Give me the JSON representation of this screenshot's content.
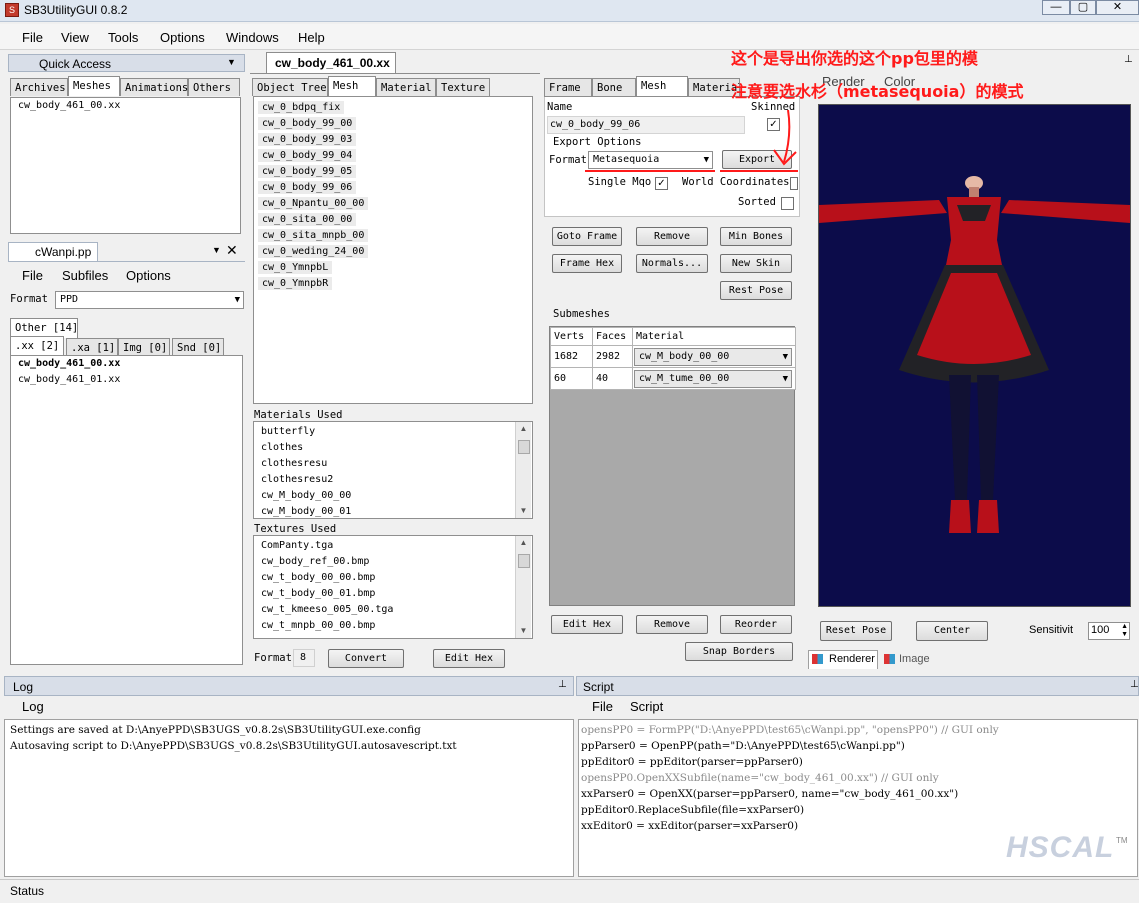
{
  "window": {
    "title": "SB3UtilityGUI 0.8.2",
    "min": "—",
    "max": "▢",
    "close": "✕"
  },
  "menu": [
    "File",
    "View",
    "Tools",
    "Options",
    "Windows",
    "Help"
  ],
  "quick_access": {
    "title": "Quick Access",
    "tabs": [
      "Archives",
      "Meshes",
      "Animations",
      "Others"
    ],
    "items": [
      "cw_body_461_00.xx"
    ]
  },
  "pp": {
    "title": "cWanpi.pp",
    "menu": [
      "File",
      "Subfiles",
      "Options"
    ],
    "format_label": "Format",
    "format_value": "PPD",
    "tab_other": "Other [14]",
    "tabs": [
      ".xx [2]",
      ".xa [1]",
      "Img [0]",
      "Snd [0]"
    ],
    "items": [
      "cw_body_461_00.xx",
      "cw_body_461_01.xx"
    ]
  },
  "xx": {
    "doc_tab": "cw_body_461_00.xx",
    "tabs": [
      "Object Tree",
      "Mesh",
      "Material",
      "Texture"
    ],
    "meshes": [
      "cw_0_bdpq_fix",
      "cw_0_body_99_00",
      "cw_0_body_99_03",
      "cw_0_body_99_04",
      "cw_0_body_99_05",
      "cw_0_body_99_06",
      "cw_0_Npantu_00_00",
      "cw_0_sita_00_00",
      "cw_0_sita_mnpb_00",
      "cw_0_weding_24_00",
      "cw_0_YmnpbL",
      "cw_0_YmnpbR"
    ],
    "materials_label": "Materials Used",
    "materials": [
      "butterfly",
      "clothes",
      "clothesresu",
      "clothesresu2",
      "cw_M_body_00_00",
      "cw_M_body_00_01"
    ],
    "textures_label": "Textures Used",
    "textures": [
      "ComPanty.tga",
      "cw_body_ref_00.bmp",
      "cw_t_body_00_00.bmp",
      "cw_t_body_00_01.bmp",
      "cw_t_kmeeso_005_00.tga",
      "cw_t_mnpb_00_00.bmp"
    ],
    "format_label": "Format",
    "format_value": "8",
    "convert": "Convert",
    "edit_hex": "Edit Hex"
  },
  "mesh_editor": {
    "tabs": [
      "Frame",
      "Bone",
      "Mesh",
      "Material"
    ],
    "name_label": "Name",
    "name_value": "cw_0_body_99_06",
    "skinned_label": "Skinned",
    "export_options": "Export Options",
    "format_label": "Format",
    "format_value": "Metasequoia",
    "export": "Export",
    "single_mqo": "Single Mqo",
    "world_coords": "World Coordinates",
    "sorted": "Sorted",
    "buttons": [
      "Goto Frame",
      "Remove",
      "Min Bones",
      "Frame Hex",
      "Normals...",
      "New Skin",
      "Rest Pose"
    ],
    "submeshes_label": "Submeshes",
    "columns": [
      "Verts",
      "Faces",
      "Material"
    ],
    "rows": [
      [
        "1682",
        "2982",
        "cw_M_body_00_00"
      ],
      [
        "60",
        "40",
        "cw_M_tume_00_00"
      ]
    ],
    "bottom_buttons": [
      "Edit Hex",
      "Remove",
      "Reorder",
      "Snap Borders"
    ]
  },
  "renderer": {
    "tabs": [
      "Render",
      "Color"
    ],
    "reset_pose": "Reset Pose",
    "center": "Center",
    "sensitivity_label": "Sensitivit",
    "sensitivity_value": "100",
    "bottom_tabs": [
      "Renderer",
      "Image"
    ],
    "bg": "#0c0c4a"
  },
  "annotations": [
    "这个是导出你选的这个pp包里的模",
    "注意要选水杉（metasequoia）的模式"
  ],
  "log": {
    "title": "Log",
    "menu": "Log",
    "lines": [
      "Settings are saved at D:\\AnyePPD\\SB3UGS_v0.8.2s\\SB3UtilityGUI.exe.config",
      "Autosaving script to D:\\AnyePPD\\SB3UGS_v0.8.2s\\SB3UtilityGUI.autosavescript.txt"
    ]
  },
  "script": {
    "title": "Script",
    "menu": [
      "File",
      "Script"
    ],
    "lines": [
      {
        "t": "opensPP0 = FormPP(\"D:\\AnyePPD\\test65\\cWanpi.pp\", \"opensPP0\") // GUI only",
        "gray": true
      },
      {
        "t": "ppParser0 = OpenPP(path=\"D:\\AnyePPD\\test65\\cWanpi.pp\")",
        "gray": false
      },
      {
        "t": "ppEditor0 = ppEditor(parser=ppParser0)",
        "gray": false
      },
      {
        "t": "opensPP0.OpenXXSubfile(name=\"cw_body_461_00.xx\") // GUI only",
        "gray": true
      },
      {
        "t": "xxParser0 = OpenXX(parser=ppParser0, name=\"cw_body_461_00.xx\")",
        "gray": false
      },
      {
        "t": "ppEditor0.ReplaceSubfile(file=xxParser0)",
        "gray": false
      },
      {
        "t": "xxEditor0 = xxEditor(parser=xxParser0)",
        "gray": false
      }
    ]
  },
  "status": "Status",
  "watermark": "HSCAL",
  "watermark_tm": "TM",
  "colors": {
    "annotation": "#ff1a1a",
    "figure_red": "#b8101a",
    "figure_dark": "#222226"
  }
}
